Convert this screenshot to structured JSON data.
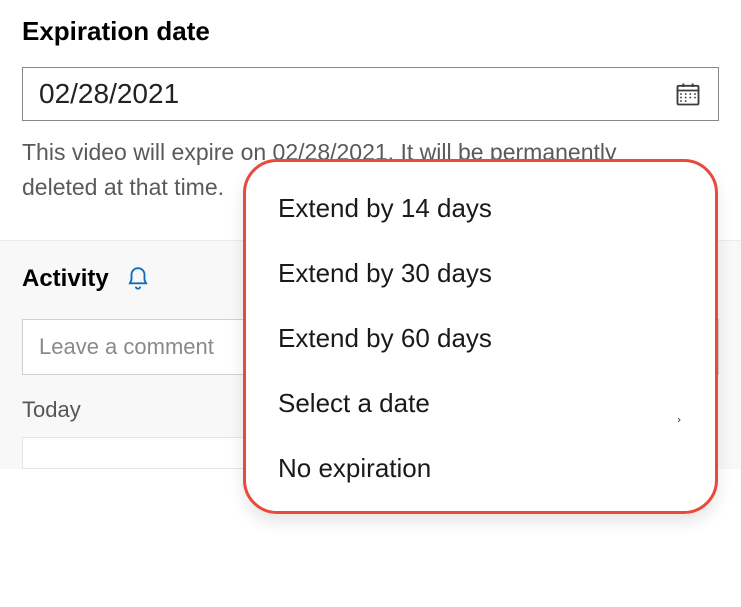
{
  "field": {
    "label": "Expiration date",
    "value": "02/28/2021",
    "helper_text": "This video will expire on 02/28/2021. It will be permanently deleted at that time."
  },
  "activity": {
    "title": "Activity",
    "comment_placeholder": "Leave a comment",
    "today_label": "Today"
  },
  "dropdown": {
    "items": [
      {
        "label": "Extend by 14 days"
      },
      {
        "label": "Extend by 30 days"
      },
      {
        "label": "Extend by 60 days"
      },
      {
        "label": "Select a date"
      },
      {
        "label": "No expiration"
      }
    ]
  },
  "colors": {
    "callout_border": "#e84a3c",
    "accent": "#0f6cbd"
  }
}
